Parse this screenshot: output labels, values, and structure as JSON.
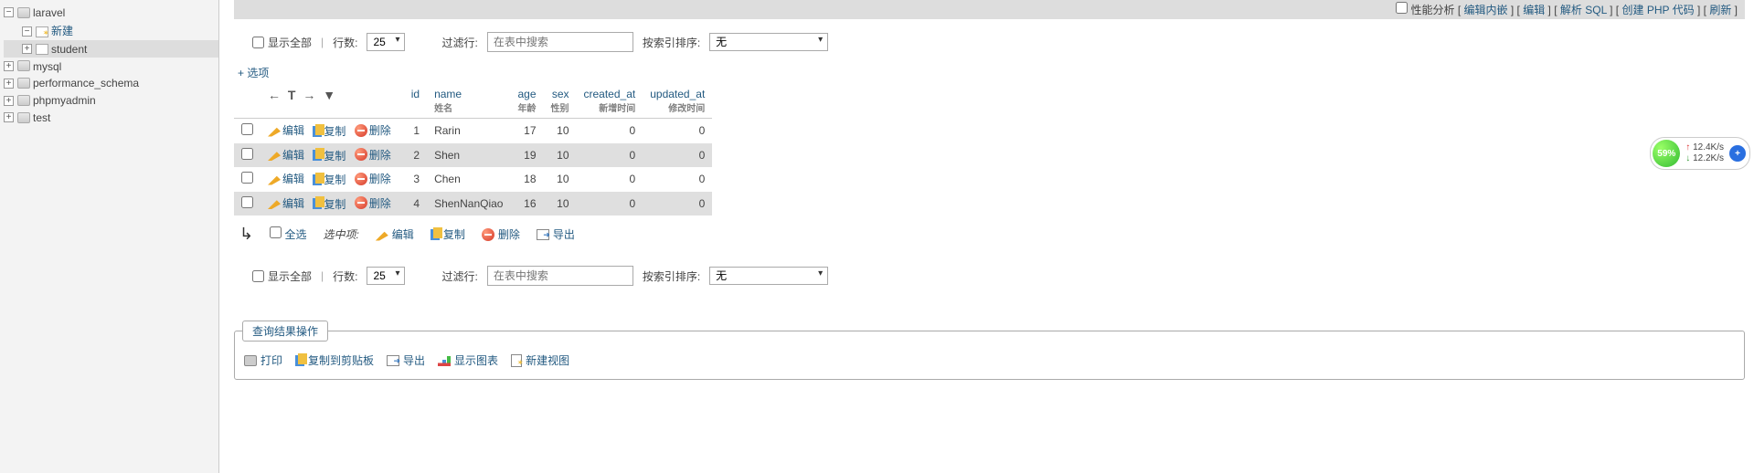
{
  "sidebar": {
    "databases": [
      {
        "name": "laravel",
        "expanded": true,
        "children_kind": "tables",
        "new_label": "新建",
        "tables": [
          {
            "name": "student",
            "selected": true
          }
        ]
      },
      {
        "name": "mysql",
        "expanded": false
      },
      {
        "name": "performance_schema",
        "expanded": false
      },
      {
        "name": "phpmyadmin",
        "expanded": false
      },
      {
        "name": "test",
        "expanded": false
      }
    ]
  },
  "topbar": {
    "profiling_label": "性能分析",
    "links": [
      "编辑内嵌",
      "编辑",
      "解析 SQL",
      "创建 PHP 代码",
      "刷新"
    ]
  },
  "controls": {
    "show_all": "显示全部",
    "rows_label": "行数:",
    "rows_value": "25",
    "filter_label": "过滤行:",
    "filter_placeholder": "在表中搜索",
    "sort_label": "按索引排序:",
    "sort_value": "无"
  },
  "options_link": "+ 选项",
  "table": {
    "actions": {
      "edit": "编辑",
      "copy": "复制",
      "delete": "删除"
    },
    "columns": [
      {
        "key": "id",
        "main": "id",
        "sub": "",
        "num": true
      },
      {
        "key": "name",
        "main": "name",
        "sub": "姓名",
        "num": false
      },
      {
        "key": "age",
        "main": "age",
        "sub": "年龄",
        "num": true
      },
      {
        "key": "sex",
        "main": "sex",
        "sub": "性别",
        "num": true
      },
      {
        "key": "created_at",
        "main": "created_at",
        "sub": "新增时间",
        "num": true
      },
      {
        "key": "updated_at",
        "main": "updated_at",
        "sub": "修改时间",
        "num": true
      }
    ],
    "rows": [
      {
        "id": 1,
        "name": "Rarin",
        "age": 17,
        "sex": 10,
        "created_at": 0,
        "updated_at": 0
      },
      {
        "id": 2,
        "name": "Shen",
        "age": 19,
        "sex": 10,
        "created_at": 0,
        "updated_at": 0
      },
      {
        "id": 3,
        "name": "Chen",
        "age": 18,
        "sex": 10,
        "created_at": 0,
        "updated_at": 0
      },
      {
        "id": 4,
        "name": "ShenNanQiao",
        "age": 16,
        "sex": 10,
        "created_at": 0,
        "updated_at": 0
      }
    ]
  },
  "bulk": {
    "check_all": "全选",
    "with_selected": "选中项:",
    "edit": "编辑",
    "copy": "复制",
    "delete": "删除",
    "export": "导出"
  },
  "result_ops": {
    "legend": "查询结果操作",
    "print": "打印",
    "copy_clip": "复制到剪贴板",
    "export": "导出",
    "chart": "显示图表",
    "create_view": "新建视图"
  },
  "speed_widget": {
    "percent": "59%",
    "up": "12.4K/s",
    "down": "12.2K/s"
  }
}
